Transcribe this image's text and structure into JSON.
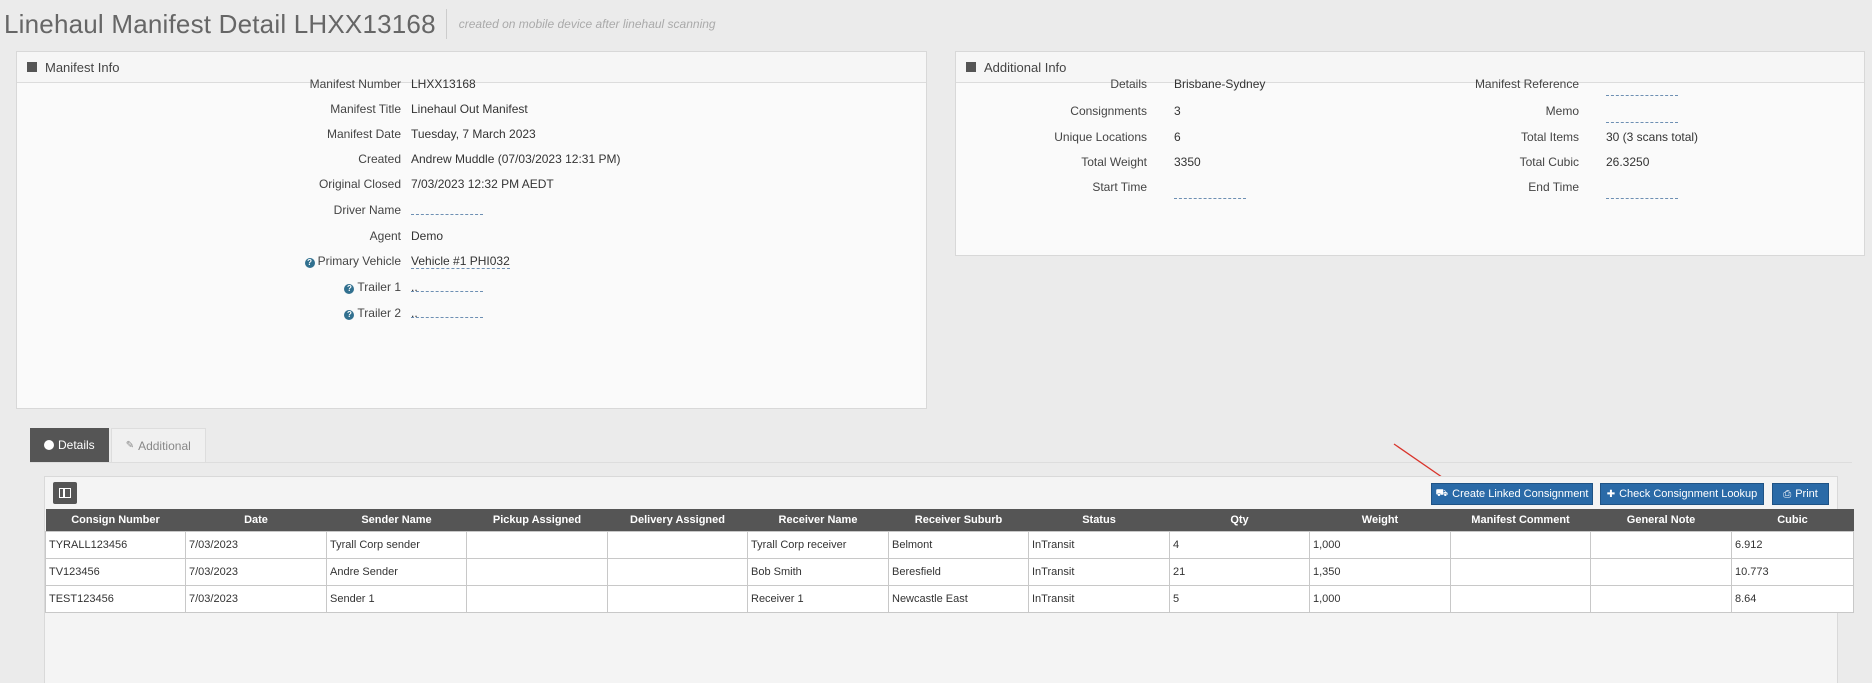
{
  "header": {
    "title": "Linehaul Manifest Detail LHXX13168",
    "subtitle": "created on mobile device after linehaul scanning"
  },
  "manifest_info": {
    "title": "Manifest Info",
    "fields": [
      {
        "label": "Manifest Number",
        "value": "LHXX13168"
      },
      {
        "label": "Manifest Title",
        "value": "Linehaul Out Manifest"
      },
      {
        "label": "Manifest Date",
        "value": "Tuesday, 7 March 2023"
      },
      {
        "label": "Created",
        "value": "Andrew Muddle (07/03/2023 12:31 PM)"
      },
      {
        "label": "Original Closed",
        "value": "7/03/2023 12:32 PM AEDT"
      },
      {
        "label": "Driver Name",
        "value": ""
      },
      {
        "label": "Agent",
        "value": "Demo"
      },
      {
        "label": "Primary Vehicle",
        "value": "Vehicle #1 PHI032"
      },
      {
        "label": "Trailer 1",
        "value": ".."
      },
      {
        "label": "Trailer 2",
        "value": ".."
      }
    ]
  },
  "additional_info": {
    "title": "Additional Info",
    "left": [
      {
        "label": "Details",
        "value": "Brisbane-Sydney"
      },
      {
        "label": "Consignments",
        "value": "3"
      },
      {
        "label": "Unique Locations",
        "value": "6"
      },
      {
        "label": "Total Weight",
        "value": "3350"
      },
      {
        "label": "Start Time",
        "value": ""
      }
    ],
    "right": [
      {
        "label": "Manifest Reference",
        "value": ""
      },
      {
        "label": "Memo",
        "value": ""
      },
      {
        "label": "Total Items",
        "value": "30 (3 scans total)"
      },
      {
        "label": "Total Cubic",
        "value": "26.3250"
      },
      {
        "label": "End Time",
        "value": ""
      }
    ]
  },
  "tabs": [
    {
      "label": "Details",
      "icon": "circle-icon"
    },
    {
      "label": "Additional",
      "icon": "pencil-icon"
    }
  ],
  "toolbar": {
    "create_linked": "Create Linked Consignment",
    "check_lookup": "Check Consignment Lookup",
    "print": "Print"
  },
  "table": {
    "columns": [
      "Consign Number",
      "Date",
      "Sender Name",
      "Pickup Assigned",
      "Delivery Assigned",
      "Receiver Name",
      "Receiver Suburb",
      "Status",
      "Qty",
      "Weight",
      "Manifest Comment",
      "General Note",
      "Cubic"
    ],
    "rows": [
      [
        "TYRALL123456",
        "7/03/2023",
        "Tyrall Corp sender",
        "",
        "",
        "Tyrall Corp receiver",
        "Belmont",
        "InTransit",
        "4",
        "1,000",
        "",
        "",
        "6.912"
      ],
      [
        "TV123456",
        "7/03/2023",
        "Andre Sender",
        "",
        "",
        "Bob Smith",
        "Beresfield",
        "InTransit",
        "21",
        "1,350",
        "",
        "",
        "10.773"
      ],
      [
        "TEST123456",
        "7/03/2023",
        "Sender 1",
        "",
        "",
        "Receiver 1",
        "Newcastle East",
        "InTransit",
        "5",
        "1,000",
        "",
        "",
        "8.64"
      ]
    ]
  },
  "colors": {
    "primary_button": "#2a6aa7",
    "dark_header": "#555555",
    "annotation_arrow": "#d9342b"
  }
}
